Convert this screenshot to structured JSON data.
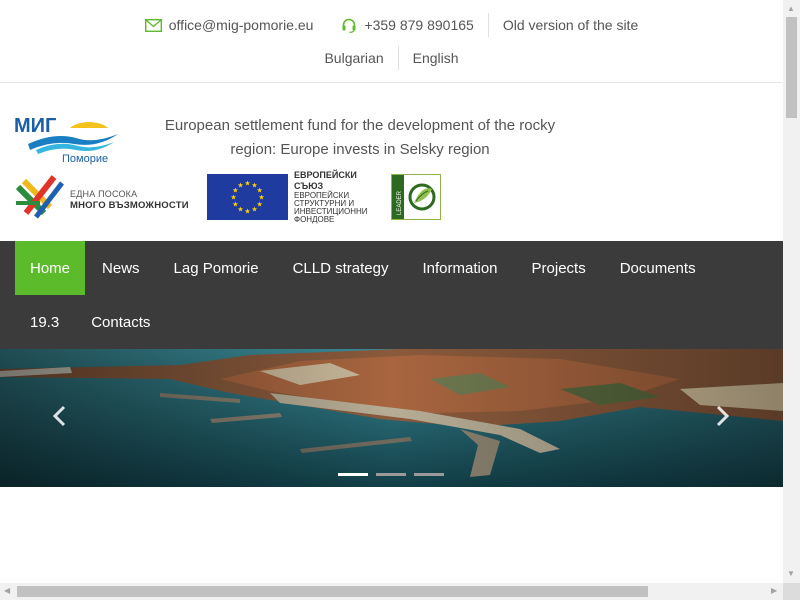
{
  "topbar": {
    "email": "office@mig-pomorie.eu",
    "phone": "+359 879 890165",
    "old_version": "Old version of the site",
    "languages": [
      "Bulgarian",
      "English"
    ],
    "accent": "#5cbb2a"
  },
  "header": {
    "logo_text": "МИГ",
    "logo_subtext": "Поморие",
    "tagline": "European settlement fund for the development of the rocky region: Europe invests in Selsky region",
    "edna_line1": "ЕДНА ПОСОКА",
    "edna_line2": "МНОГО ВЪЗМОЖНОСТИ",
    "eu_title": "ЕВРОПЕЙСКИ СЪЮЗ",
    "eu_line1": "ЕВРОПЕЙСКИ СТРУКТУРНИ И",
    "eu_line2": "ИНВЕСТИЦИОННИ ФОНДОВЕ",
    "leader_text": "LEADER"
  },
  "nav": {
    "row1": [
      "Home",
      "News",
      "Lag Pomorie",
      "CLLD strategy",
      "Information",
      "Projects",
      "Documents"
    ],
    "row2": [
      "19.3",
      "Contacts"
    ],
    "active": "Home",
    "bg": "#3b3b3b",
    "active_bg": "#5cbb2a"
  },
  "slider": {
    "prev_icon": "chevron-left-icon",
    "next_icon": "chevron-right-icon",
    "slides": 3,
    "active_slide": 1
  }
}
